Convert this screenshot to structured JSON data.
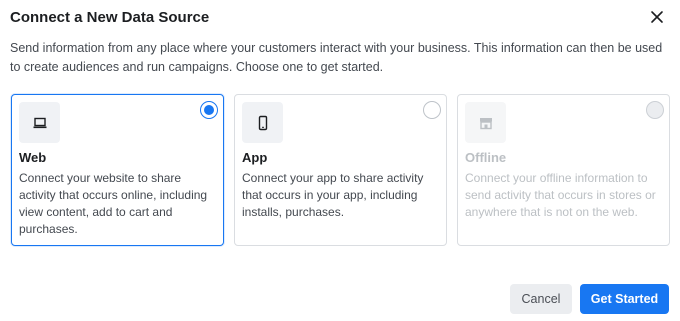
{
  "dialog": {
    "title": "Connect a New Data Source",
    "close_icon": "close-icon",
    "description": "Send information from any place where your customers interact with your business. This information can then be used to create audiences and run campaigns. Choose one to get started."
  },
  "options": [
    {
      "title": "Web",
      "description": "Connect your website to share activity that occurs online, including view content, add to cart and purchases.",
      "icon": "laptop-icon",
      "selected": true,
      "disabled": false
    },
    {
      "title": "App",
      "description": "Connect your app to share activity that occurs in your app, including installs, purchases.",
      "icon": "mobile-phone-icon",
      "selected": false,
      "disabled": false
    },
    {
      "title": "Offline",
      "description": "Connect your offline information to send activity that occurs in stores or anywhere that is not on the web.",
      "icon": "store-icon",
      "selected": false,
      "disabled": true
    }
  ],
  "footer": {
    "cancel_label": "Cancel",
    "submit_label": "Get Started"
  },
  "colors": {
    "accent": "#1877f2",
    "border": "#dadde1",
    "disabled_text": "#bcc0c4"
  }
}
